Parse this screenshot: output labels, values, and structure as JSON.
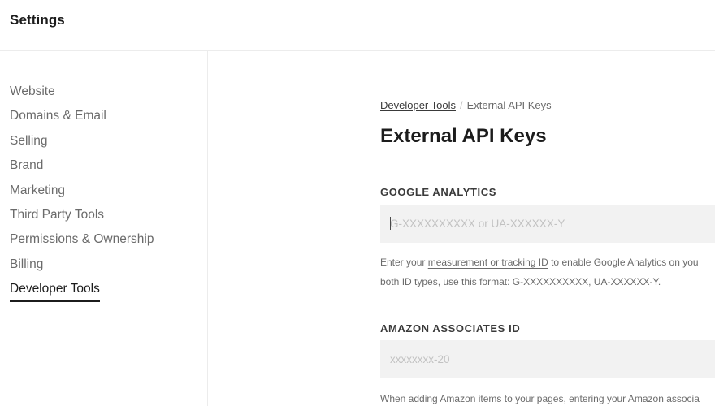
{
  "header": {
    "title": "Settings"
  },
  "sidebar": {
    "items": [
      {
        "label": "Website",
        "active": false
      },
      {
        "label": "Domains & Email",
        "active": false
      },
      {
        "label": "Selling",
        "active": false
      },
      {
        "label": "Brand",
        "active": false
      },
      {
        "label": "Marketing",
        "active": false
      },
      {
        "label": "Third Party Tools",
        "active": false
      },
      {
        "label": "Permissions & Ownership",
        "active": false
      },
      {
        "label": "Billing",
        "active": false
      },
      {
        "label": "Developer Tools",
        "active": true
      }
    ]
  },
  "breadcrumb": {
    "parent": "Developer Tools",
    "separator": "/",
    "current": "External API Keys"
  },
  "page": {
    "title": "External API Keys"
  },
  "fields": {
    "google_analytics": {
      "label": "GOOGLE ANALYTICS",
      "value": "",
      "placeholder": "G-XXXXXXXXXX or UA-XXXXXX-Y",
      "help_prefix": "Enter your ",
      "help_link": "measurement or tracking ID",
      "help_suffix": " to enable Google Analytics on you",
      "help_line2": "both ID types, use this format: G-XXXXXXXXXX, UA-XXXXXX-Y."
    },
    "amazon_associates": {
      "label": "AMAZON ASSOCIATES ID",
      "value": "",
      "placeholder": "xxxxxxxx-20",
      "help_line1": "When adding Amazon items to your pages, entering your Amazon associa"
    }
  }
}
